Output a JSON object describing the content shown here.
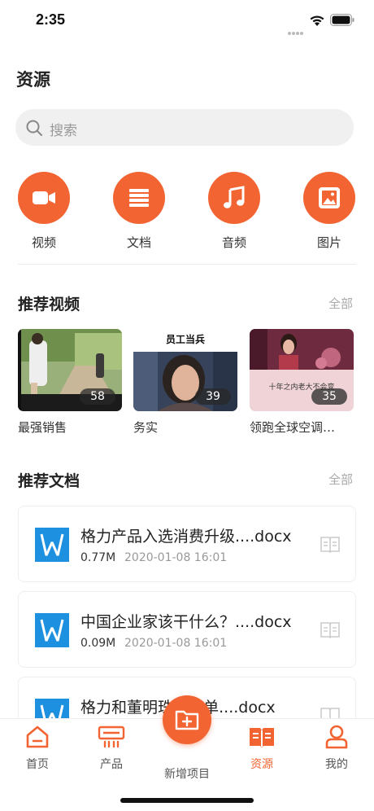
{
  "status": {
    "time": "2:35"
  },
  "page": {
    "title": "资源"
  },
  "search": {
    "placeholder": "搜索"
  },
  "categories": [
    {
      "label": "视频",
      "icon": "video-camera-icon"
    },
    {
      "label": "文档",
      "icon": "document-lines-icon"
    },
    {
      "label": "音频",
      "icon": "music-note-icon"
    },
    {
      "label": "图片",
      "icon": "image-icon"
    }
  ],
  "videos_section": {
    "title": "推荐视频",
    "more": "全部"
  },
  "videos": [
    {
      "title": "最强销售",
      "count": "58"
    },
    {
      "title": "务实",
      "count": "39",
      "thumb_caption": "员工当兵"
    },
    {
      "title": "领跑全球空调…",
      "count": "35",
      "thumb_caption": "十年之内老大不会变"
    }
  ],
  "docs_section": {
    "title": "推荐文档",
    "more": "全部"
  },
  "docs": [
    {
      "name": "格力产品入选消费升级....docx",
      "size": "0.77M",
      "date": "2020-01-08 16:01"
    },
    {
      "name": "中国企业家该干什么？....docx",
      "size": "0.09M",
      "date": "2020-01-08 16:01"
    },
    {
      "name": "格力和董明珠...榜单....docx",
      "size": "",
      "date": ""
    }
  ],
  "tabs": [
    {
      "label": "首页",
      "icon": "home-icon"
    },
    {
      "label": "产品",
      "icon": "air-conditioner-icon"
    },
    {
      "label": "新增项目",
      "icon": "add-folder-icon"
    },
    {
      "label": "资源",
      "icon": "book-open-icon"
    },
    {
      "label": "我的",
      "icon": "user-icon"
    }
  ],
  "colors": {
    "accent": "#f26431",
    "text": "#222222",
    "muted": "#999999",
    "word_blue": "#1e90e0"
  }
}
